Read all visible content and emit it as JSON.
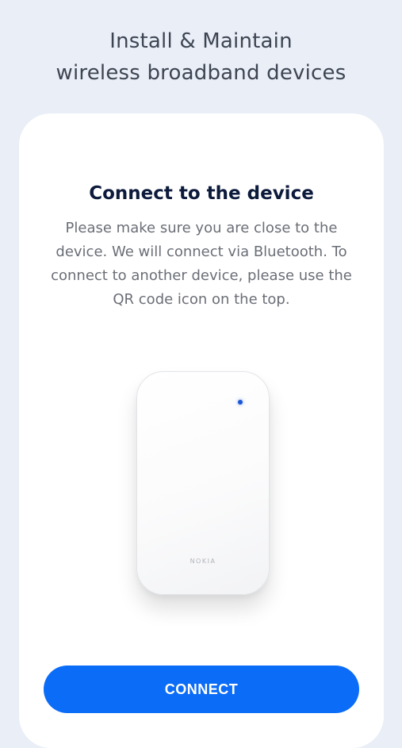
{
  "header": {
    "line1": "Install & Maintain",
    "line2": "wireless broadband devices"
  },
  "card": {
    "title": "Connect to the device",
    "description": "Please make sure you are close to the device. We will connect via Bluetooth. To connect to another device, please use the QR code icon on the top."
  },
  "device": {
    "logo_text": "NOKIA",
    "led_color": "#1a56d6"
  },
  "actions": {
    "connect_label": "CONNECT"
  },
  "colors": {
    "background": "#e9eef7",
    "accent": "#0b6cf7",
    "title": "#0c1a3b"
  }
}
